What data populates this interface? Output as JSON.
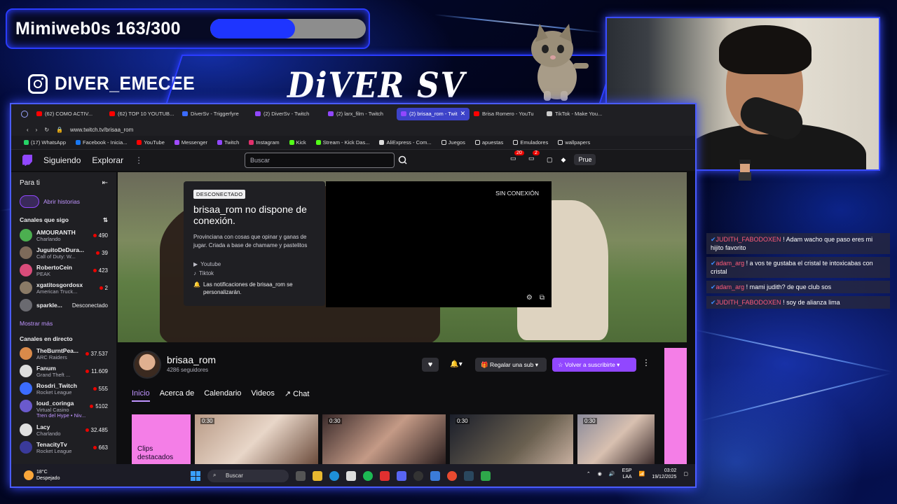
{
  "overlay": {
    "goal_text": "Mimiweb0s 163/300",
    "goal_progress": 0.543,
    "social_handle": "DIVER_EMECEE",
    "brand": "DiVER SV"
  },
  "chat": [
    {
      "user": "JUDITH_FABODOXEN",
      "text": " ! Adam wacho que paso eres mi hijito favorito"
    },
    {
      "user": "adam_arg",
      "text": " ! a vos te gustaba el cristal te intoxicabas con cristal"
    },
    {
      "user": "adam_arg",
      "text": " ! mami judith? de que club sos"
    },
    {
      "user": "JUDITH_FABODOXEN",
      "text": " ! soy de alianza lima"
    }
  ],
  "browser": {
    "tabs": [
      {
        "label": "(62) COMO ACTIV...",
        "color": "#ff0000"
      },
      {
        "label": "(62) TOP 10 YOUTUB...",
        "color": "#ff0000"
      },
      {
        "label": "DiverSv - Triggerfyre",
        "color": "#3b6cff"
      },
      {
        "label": "(2) DiverSv - Twitch",
        "color": "#9147ff"
      },
      {
        "label": "(2) larx_film - Twitch",
        "color": "#9147ff"
      },
      {
        "label": "(2) brisaa_rom - Twit",
        "color": "#9147ff",
        "active": true
      },
      {
        "label": "Brisa Romero - YouTu",
        "color": "#ff0000"
      },
      {
        "label": "TikTok - Make You...",
        "color": "#cccccc"
      }
    ],
    "url": "www.twitch.tv/brisaa_rom",
    "bookmarks": [
      {
        "label": "(17) WhatsApp",
        "color": "#25d366"
      },
      {
        "label": "Facebook - Inicia...",
        "color": "#1877f2"
      },
      {
        "label": "YouTube",
        "color": "#ff0000"
      },
      {
        "label": "Messenger",
        "color": "#a04bff"
      },
      {
        "label": "Twitch",
        "color": "#9147ff"
      },
      {
        "label": "Instagram",
        "color": "#e1306c"
      },
      {
        "label": "Kick",
        "color": "#53fc18"
      },
      {
        "label": "Stream - Kick Das...",
        "color": "#53fc18"
      },
      {
        "label": "AliExpress - Com...",
        "color": "#dddddd"
      },
      {
        "label": "Juegos",
        "color": "#dddddd"
      },
      {
        "label": "apuestas",
        "color": "#dddddd"
      },
      {
        "label": "Emuladores",
        "color": "#dddddd"
      },
      {
        "label": "wallpapers",
        "color": "#dddddd"
      }
    ]
  },
  "twitch": {
    "nav": {
      "following": "Siguiendo",
      "browse": "Explorar",
      "search_placeholder": "Buscar",
      "notif1": "20",
      "notif2": "2",
      "prime": "Prue"
    },
    "sidebar": {
      "title": "Para ti",
      "history": "Abrir historias",
      "followed_title": "Canales que sigo",
      "followed": [
        {
          "name": "AMOURANTH",
          "game": "Charlando",
          "viewers": "490",
          "color": "#4caf50"
        },
        {
          "name": "JuguitoDeDura...",
          "game": "Call of Duty: W...",
          "viewers": "39",
          "color": "#7d6a5a"
        },
        {
          "name": "RobertoCein",
          "game": "PEAK",
          "viewers": "423",
          "color": "#d94c7a"
        },
        {
          "name": "xgatitosgordosx",
          "game": "American Truck...",
          "viewers": "2",
          "color": "#8a7a66"
        },
        {
          "name": "sparkle...",
          "game": "",
          "viewers": "Desconectado",
          "color": "#6a6a70",
          "offline": true
        }
      ],
      "show_more": "Mostrar más",
      "live_title": "Canales en directo",
      "live": [
        {
          "name": "TheBurntPea...",
          "game": "ARC Raiders",
          "viewers": "37.537",
          "color": "#d98a4a"
        },
        {
          "name": "Fanum",
          "game": "Grand Theft ...",
          "viewers": "11.609",
          "color": "#dddddd"
        },
        {
          "name": "Rosdri_Twitch",
          "game": "Rocket League",
          "viewers": "555",
          "color": "#3b6cff"
        },
        {
          "name": "loud_coringa",
          "game": "Virtual Casino",
          "viewers": "5102",
          "color": "#6a5acd",
          "extra": "Tren del Hype • Niv..."
        },
        {
          "name": "Lacy",
          "game": "Charlando",
          "viewers": "32.485",
          "color": "#e0e0e0"
        },
        {
          "name": "TenacityTv",
          "game": "Rocket League",
          "viewers": "663",
          "color": "#3a3a9a"
        }
      ]
    },
    "offline": {
      "badge": "DESCONECTADO",
      "title": "brisaa_rom no dispone de conexión.",
      "desc": "Provinciana con cosas que opinar y ganas de jugar. Criada a base de chamame y pastelitos",
      "youtube": "Youtube",
      "tiktok": "Tiktok",
      "notice": "Las notificaciones de brisaa_rom se personalizarán.",
      "player_label": "SIN CONEXIÓN"
    },
    "channel": {
      "name": "brisaa_rom",
      "followers": "4286 seguidores",
      "gift": "Regalar una sub",
      "subscribe": "Volver a suscribirte",
      "tabs": [
        "Inicio",
        "Acerca de",
        "Calendario",
        "Videos",
        "Chat"
      ]
    },
    "clips": {
      "card_label": "Clips destacados",
      "durations": [
        "0:30",
        "0:30",
        "0:30",
        "0:30"
      ]
    }
  },
  "taskbar": {
    "weather_temp": "18°C",
    "weather_desc": "Despejado",
    "search": "Buscar",
    "lang1": "ESP",
    "lang2": "LAA",
    "time": "03:02",
    "date": "19/12/2025"
  }
}
